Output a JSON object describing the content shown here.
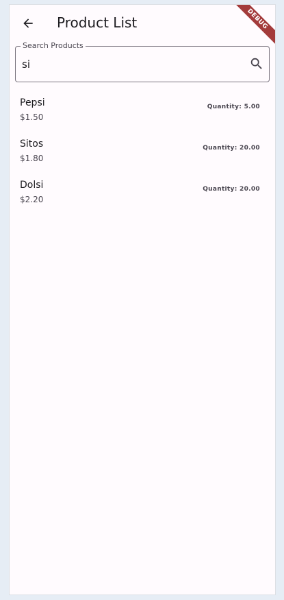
{
  "app_bar": {
    "title": "Product List",
    "back_icon": "arrow-back-icon",
    "debug_banner": "DEBUG"
  },
  "search": {
    "label": "Search Products",
    "value": "si",
    "icon": "search-icon"
  },
  "products": [
    {
      "name": "Pepsi",
      "price": "$1.50",
      "quantity": "Quantity: 5.00"
    },
    {
      "name": "Sitos",
      "price": "$1.80",
      "quantity": "Quantity: 20.00"
    },
    {
      "name": "Dolsi",
      "price": "$2.20",
      "quantity": "Quantity: 20.00"
    }
  ],
  "colors": {
    "background": "#fffbfe",
    "debug_ribbon": "#a33b3b",
    "outline": "#79747e"
  }
}
